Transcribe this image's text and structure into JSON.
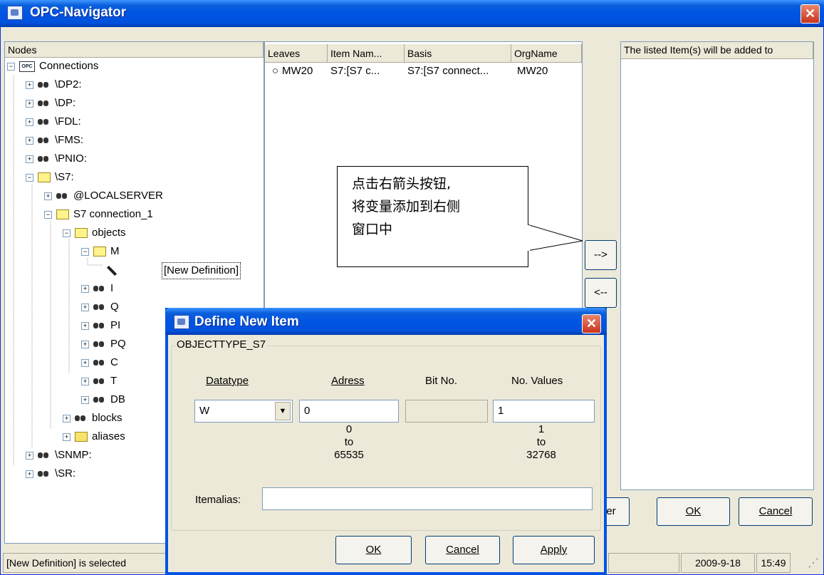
{
  "window": {
    "title": "OPC-Navigator",
    "close": "✕"
  },
  "nodes_panel": {
    "header": "Nodes",
    "tree": [
      {
        "label": "Connections"
      },
      {
        "label": "\\DP2:"
      },
      {
        "label": "\\DP:"
      },
      {
        "label": "\\FDL:"
      },
      {
        "label": "\\FMS:"
      },
      {
        "label": "\\PNIO:"
      },
      {
        "label": "\\S7:"
      },
      {
        "label": "@LOCALSERVER"
      },
      {
        "label": "S7 connection_1"
      },
      {
        "label": "objects"
      },
      {
        "label": "M"
      },
      {
        "label": "[New Definition]"
      },
      {
        "label": "I"
      },
      {
        "label": "Q"
      },
      {
        "label": "PI"
      },
      {
        "label": "PQ"
      },
      {
        "label": "C"
      },
      {
        "label": "T"
      },
      {
        "label": "DB"
      },
      {
        "label": "blocks"
      },
      {
        "label": "aliases"
      },
      {
        "label": "\\SNMP:"
      },
      {
        "label": "\\SR:"
      }
    ]
  },
  "leaves_panel": {
    "columns": [
      "Leaves",
      "Item Nam...",
      "Basis",
      "OrgName"
    ],
    "rows": [
      {
        "leaf": "MW20",
        "item": "S7:[S7 c...",
        "basis": "S7:[S7 connect...",
        "org": "MW20"
      }
    ]
  },
  "arrows": {
    "add": "-->",
    "remove": "<--"
  },
  "right_panel": {
    "header": "The listed Item(s) will be added to"
  },
  "bottom_buttons": {
    "filter": "Filter",
    "ok": "OK",
    "cancel": "Cancel"
  },
  "callout": {
    "lines": [
      "点击右箭头按钮,",
      "将变量添加到右侧",
      "窗口中"
    ]
  },
  "status": {
    "text": "[New Definition] is selected",
    "date": "2009-9-18",
    "time": "15:49"
  },
  "dialog": {
    "title": "Define New Item",
    "group": "OBJECTTYPE_S7",
    "labels": {
      "datatype": "Datatype",
      "adress": "Adress",
      "bitno": "Bit No.",
      "novalues": "No. Values",
      "itemalias": "Itemalias:"
    },
    "values": {
      "datatype": "W",
      "adress": "0",
      "bitno": "",
      "novalues": "1",
      "itemalias": ""
    },
    "ranges": {
      "adress": [
        "0",
        "to",
        "65535"
      ],
      "novalues": [
        "1",
        "to",
        "32768"
      ]
    },
    "buttons": {
      "ok": "OK",
      "cancel": "Cancel",
      "apply": "Apply"
    }
  }
}
